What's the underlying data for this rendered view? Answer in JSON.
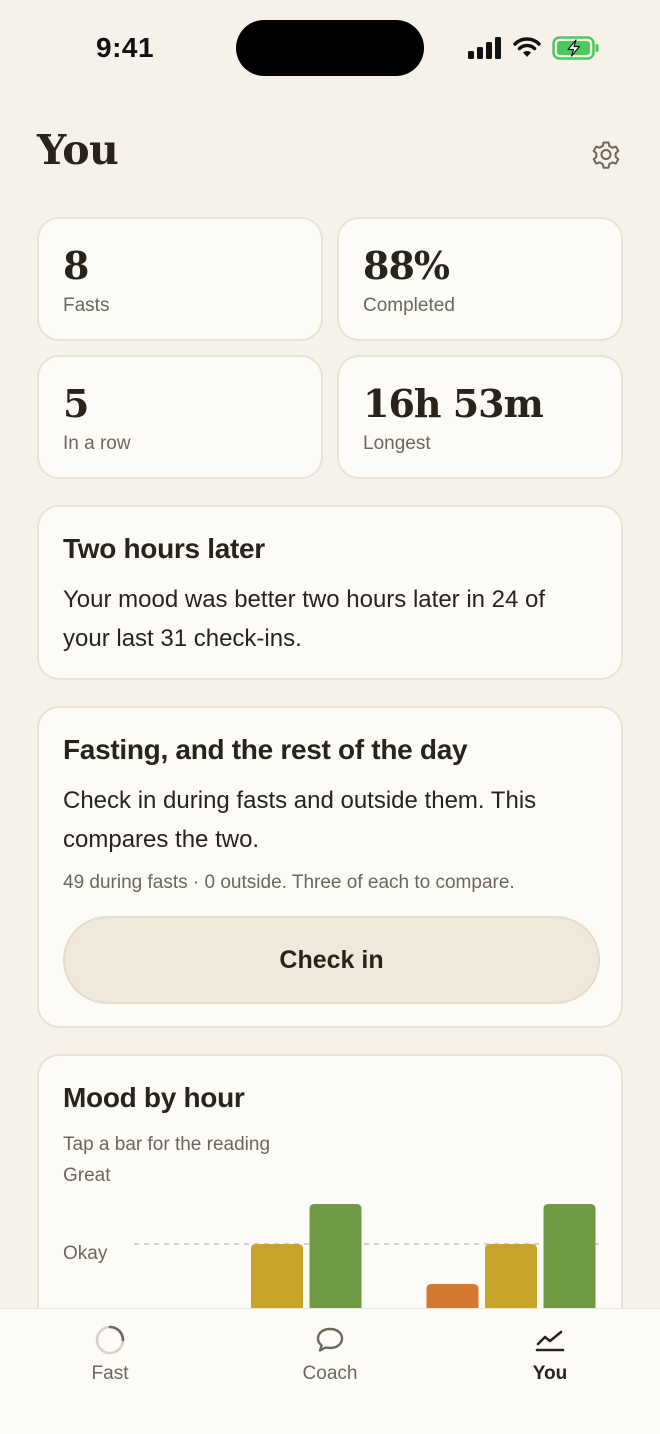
{
  "status_bar": {
    "time": "9:41"
  },
  "header": {
    "title": "You"
  },
  "stats": [
    {
      "value": "8",
      "label": "Fasts"
    },
    {
      "value": "88%",
      "label": "Completed"
    },
    {
      "value": "5",
      "label": "In a row"
    },
    {
      "value": "16h 53m",
      "label": "Longest"
    }
  ],
  "insight_card": {
    "title": "Two hours later",
    "body": "Your mood was better two hours later in 24 of your last 31 check-ins."
  },
  "compare_card": {
    "title": "Fasting, and the rest of the day",
    "body": "Check in during fasts and outside them. This compares the two.",
    "note": "49 during fasts · 0 outside. Three of each to compare.",
    "button_label": "Check in"
  },
  "mood_chart": {
    "title": "Mood by hour",
    "subtitle": "Tap a bar for the reading",
    "y_labels": [
      "Great",
      "Okay"
    ]
  },
  "chart_data": {
    "type": "bar",
    "title": "Mood by hour",
    "y_categories": [
      "Great",
      "Okay"
    ],
    "values": [
      null,
      null,
      2,
      3,
      null,
      1,
      2,
      3
    ],
    "bar_colors": [
      null,
      null,
      "#c9a42b",
      "#6f9a44",
      null,
      "#d4792f",
      "#c9a42b",
      "#6f9a44"
    ],
    "reference_line": "Okay",
    "grid": false
  },
  "colors": {
    "background": "#f6f2ea",
    "card": "#fdfbf7",
    "good": "#6f9a44",
    "okay": "#c9a42b",
    "low": "#d4792f",
    "battery": "#4cc95e"
  },
  "tabs": [
    {
      "label": "Fast",
      "icon": "progress-ring-icon",
      "active": false
    },
    {
      "label": "Coach",
      "icon": "chat-bubble-icon",
      "active": false
    },
    {
      "label": "You",
      "icon": "trend-chart-icon",
      "active": true
    }
  ]
}
